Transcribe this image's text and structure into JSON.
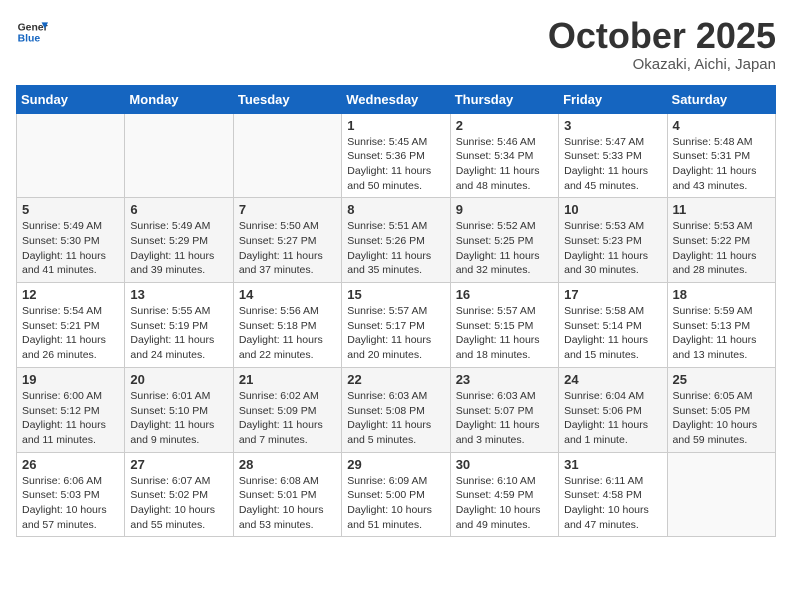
{
  "header": {
    "logo_line1": "General",
    "logo_line2": "Blue",
    "month": "October 2025",
    "location": "Okazaki, Aichi, Japan"
  },
  "weekdays": [
    "Sunday",
    "Monday",
    "Tuesday",
    "Wednesday",
    "Thursday",
    "Friday",
    "Saturday"
  ],
  "weeks": [
    [
      {
        "day": "",
        "info": ""
      },
      {
        "day": "",
        "info": ""
      },
      {
        "day": "",
        "info": ""
      },
      {
        "day": "1",
        "info": "Sunrise: 5:45 AM\nSunset: 5:36 PM\nDaylight: 11 hours\nand 50 minutes."
      },
      {
        "day": "2",
        "info": "Sunrise: 5:46 AM\nSunset: 5:34 PM\nDaylight: 11 hours\nand 48 minutes."
      },
      {
        "day": "3",
        "info": "Sunrise: 5:47 AM\nSunset: 5:33 PM\nDaylight: 11 hours\nand 45 minutes."
      },
      {
        "day": "4",
        "info": "Sunrise: 5:48 AM\nSunset: 5:31 PM\nDaylight: 11 hours\nand 43 minutes."
      }
    ],
    [
      {
        "day": "5",
        "info": "Sunrise: 5:49 AM\nSunset: 5:30 PM\nDaylight: 11 hours\nand 41 minutes."
      },
      {
        "day": "6",
        "info": "Sunrise: 5:49 AM\nSunset: 5:29 PM\nDaylight: 11 hours\nand 39 minutes."
      },
      {
        "day": "7",
        "info": "Sunrise: 5:50 AM\nSunset: 5:27 PM\nDaylight: 11 hours\nand 37 minutes."
      },
      {
        "day": "8",
        "info": "Sunrise: 5:51 AM\nSunset: 5:26 PM\nDaylight: 11 hours\nand 35 minutes."
      },
      {
        "day": "9",
        "info": "Sunrise: 5:52 AM\nSunset: 5:25 PM\nDaylight: 11 hours\nand 32 minutes."
      },
      {
        "day": "10",
        "info": "Sunrise: 5:53 AM\nSunset: 5:23 PM\nDaylight: 11 hours\nand 30 minutes."
      },
      {
        "day": "11",
        "info": "Sunrise: 5:53 AM\nSunset: 5:22 PM\nDaylight: 11 hours\nand 28 minutes."
      }
    ],
    [
      {
        "day": "12",
        "info": "Sunrise: 5:54 AM\nSunset: 5:21 PM\nDaylight: 11 hours\nand 26 minutes."
      },
      {
        "day": "13",
        "info": "Sunrise: 5:55 AM\nSunset: 5:19 PM\nDaylight: 11 hours\nand 24 minutes."
      },
      {
        "day": "14",
        "info": "Sunrise: 5:56 AM\nSunset: 5:18 PM\nDaylight: 11 hours\nand 22 minutes."
      },
      {
        "day": "15",
        "info": "Sunrise: 5:57 AM\nSunset: 5:17 PM\nDaylight: 11 hours\nand 20 minutes."
      },
      {
        "day": "16",
        "info": "Sunrise: 5:57 AM\nSunset: 5:15 PM\nDaylight: 11 hours\nand 18 minutes."
      },
      {
        "day": "17",
        "info": "Sunrise: 5:58 AM\nSunset: 5:14 PM\nDaylight: 11 hours\nand 15 minutes."
      },
      {
        "day": "18",
        "info": "Sunrise: 5:59 AM\nSunset: 5:13 PM\nDaylight: 11 hours\nand 13 minutes."
      }
    ],
    [
      {
        "day": "19",
        "info": "Sunrise: 6:00 AM\nSunset: 5:12 PM\nDaylight: 11 hours\nand 11 minutes."
      },
      {
        "day": "20",
        "info": "Sunrise: 6:01 AM\nSunset: 5:10 PM\nDaylight: 11 hours\nand 9 minutes."
      },
      {
        "day": "21",
        "info": "Sunrise: 6:02 AM\nSunset: 5:09 PM\nDaylight: 11 hours\nand 7 minutes."
      },
      {
        "day": "22",
        "info": "Sunrise: 6:03 AM\nSunset: 5:08 PM\nDaylight: 11 hours\nand 5 minutes."
      },
      {
        "day": "23",
        "info": "Sunrise: 6:03 AM\nSunset: 5:07 PM\nDaylight: 11 hours\nand 3 minutes."
      },
      {
        "day": "24",
        "info": "Sunrise: 6:04 AM\nSunset: 5:06 PM\nDaylight: 11 hours\nand 1 minute."
      },
      {
        "day": "25",
        "info": "Sunrise: 6:05 AM\nSunset: 5:05 PM\nDaylight: 10 hours\nand 59 minutes."
      }
    ],
    [
      {
        "day": "26",
        "info": "Sunrise: 6:06 AM\nSunset: 5:03 PM\nDaylight: 10 hours\nand 57 minutes."
      },
      {
        "day": "27",
        "info": "Sunrise: 6:07 AM\nSunset: 5:02 PM\nDaylight: 10 hours\nand 55 minutes."
      },
      {
        "day": "28",
        "info": "Sunrise: 6:08 AM\nSunset: 5:01 PM\nDaylight: 10 hours\nand 53 minutes."
      },
      {
        "day": "29",
        "info": "Sunrise: 6:09 AM\nSunset: 5:00 PM\nDaylight: 10 hours\nand 51 minutes."
      },
      {
        "day": "30",
        "info": "Sunrise: 6:10 AM\nSunset: 4:59 PM\nDaylight: 10 hours\nand 49 minutes."
      },
      {
        "day": "31",
        "info": "Sunrise: 6:11 AM\nSunset: 4:58 PM\nDaylight: 10 hours\nand 47 minutes."
      },
      {
        "day": "",
        "info": ""
      }
    ]
  ]
}
